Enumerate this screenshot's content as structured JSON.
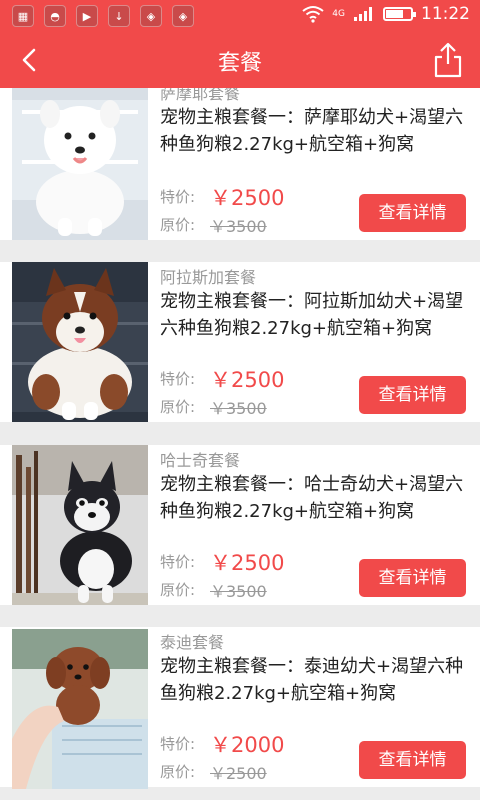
{
  "status_bar": {
    "icons": [
      "gallery-icon",
      "shield-icon",
      "video-icon",
      "download-icon",
      "app-shield-icon",
      "app-shield-icon-2"
    ],
    "time": "11:22",
    "network_label": "4G",
    "battery_level": 0.7
  },
  "nav": {
    "title": "套餐",
    "back_icon": "chevron-left-icon",
    "share_icon": "share-icon"
  },
  "colors": {
    "primary": "#f14a4a",
    "text_dark": "#222222",
    "text_gray": "#999999",
    "background": "#ececec"
  },
  "labels": {
    "sale": "特价:",
    "original": "原价:",
    "detail_button": "查看详情"
  },
  "packages": [
    {
      "name": "萨摩耶套餐",
      "description": "宠物主粮套餐一：萨摩耶幼犬+渴望六种鱼狗粮2.27kg+航空箱+狗窝",
      "sale_price": "￥2500",
      "original_price": "￥3500",
      "image_subject": "samoyed-puppy"
    },
    {
      "name": "阿拉斯加套餐",
      "description": "宠物主粮套餐一：阿拉斯加幼犬+渴望六种鱼狗粮2.27kg+航空箱+狗窝",
      "sale_price": "￥2500",
      "original_price": "￥3500",
      "image_subject": "alaskan-malamute-puppy"
    },
    {
      "name": "哈士奇套餐",
      "description": "宠物主粮套餐一：哈士奇幼犬+渴望六种鱼狗粮2.27kg+航空箱+狗窝",
      "sale_price": "￥2500",
      "original_price": "￥3500",
      "image_subject": "husky-puppy"
    },
    {
      "name": "泰迪套餐",
      "description": "宠物主粮套餐一：泰迪幼犬+渴望六种鱼狗粮2.27kg+航空箱+狗窝",
      "sale_price": "￥2000",
      "original_price": "￥2500",
      "image_subject": "teddy-poodle-puppy"
    }
  ]
}
